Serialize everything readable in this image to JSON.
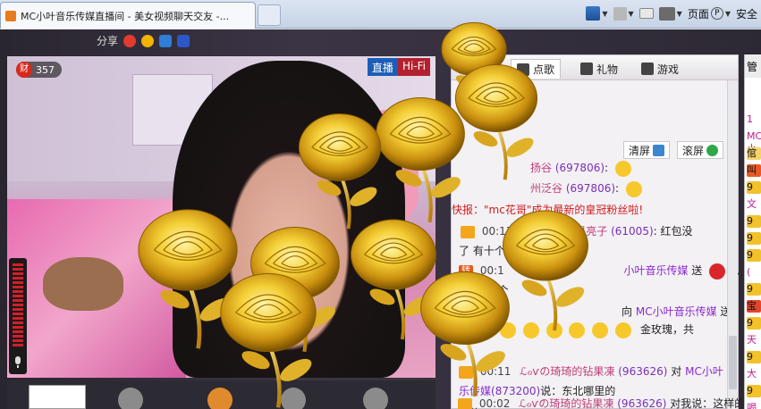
{
  "browser": {
    "tab_title": "MC小叶音乐传媒直播间 - 美女视频聊天交友 -...",
    "page_menu": "页面",
    "safety_menu": "安全",
    "page_hotkey": "P"
  },
  "share": {
    "label": "分享"
  },
  "video": {
    "wealth_icon": "财",
    "wealth_count": "357",
    "live_label": "直播",
    "hifi_label": "Hi-Fi"
  },
  "chat": {
    "tabs": [
      {
        "label": "点歌"
      },
      {
        "label": "礼物"
      },
      {
        "label": "游戏"
      }
    ],
    "clear_label": "清屏",
    "scroll_label": "滚屏",
    "messages": {
      "m1_name": "扬谷",
      "m1_num": "(697806)",
      "m2_name": "州泛谷",
      "m2_num": "(697806)",
      "m3_prefix": "快报：",
      "m3_text": "\"mc花哥\"成为最新的皇冠粉丝啦!",
      "m4_time": "00:11",
      "m4_name": "东北哥，俺是亮子",
      "m4_num": "(61005)",
      "m4_text": ": 红包没",
      "m5_text": "了    有十个迷",
      "m6_badge": "转",
      "m6_time": "00:1",
      "m6_mc": "小叶音乐传媒",
      "m6_send": "送",
      "m6_tail": "么",
      "m7_text": "么，共1个",
      "m8_to": "向",
      "m8_mc": "MC小叶音乐传媒",
      "m8_send": "送",
      "m9_text": "金玫瑰，共",
      "m10_time": "00:11",
      "m10_name": "ℒℴѵの琦琦的钻果凍",
      "m10_num": "(963626)",
      "m10_to": "对",
      "m10_mc": "MC小叶",
      "m11_mc": "乐传媒",
      "m11_num": "(873200)",
      "m11_text": "说：东北哪里的",
      "m12_text": "呈的",
      "m13_time": "00:02",
      "m13_name": "ℒℴѵの琦琦的钻果凍",
      "m13_num": "(963626)",
      "m13_text": "对我说：这样的"
    }
  },
  "sidebar": {
    "header": "管",
    "items": [
      "1",
      "MC小",
      "倌",
      "叫",
      "9",
      "文",
      "9",
      "9",
      "9",
      "(",
      "9",
      "宝",
      "9",
      "天",
      "9",
      "大",
      "9",
      "喝"
    ]
  }
}
